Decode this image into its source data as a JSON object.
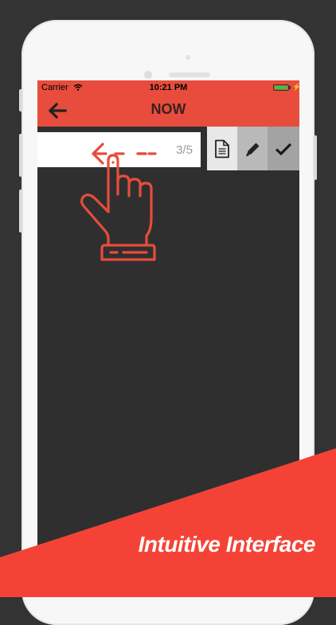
{
  "status_bar": {
    "carrier": "Carrier",
    "time": "10:21 PM",
    "battery_level": 1.0
  },
  "nav": {
    "title": "NOW",
    "back_icon": "arrow-left-icon"
  },
  "row": {
    "counter": "3/5",
    "swipe_hint_icon": "swipe-left-hand-icon"
  },
  "actions": [
    {
      "icon": "document-icon"
    },
    {
      "icon": "pencil-icon"
    },
    {
      "icon": "checkmark-icon"
    }
  ],
  "banner": {
    "caption": "Intuitive Interface"
  },
  "colors": {
    "accent": "#e74c3c",
    "background": "#333333",
    "banner": "#f44336"
  }
}
